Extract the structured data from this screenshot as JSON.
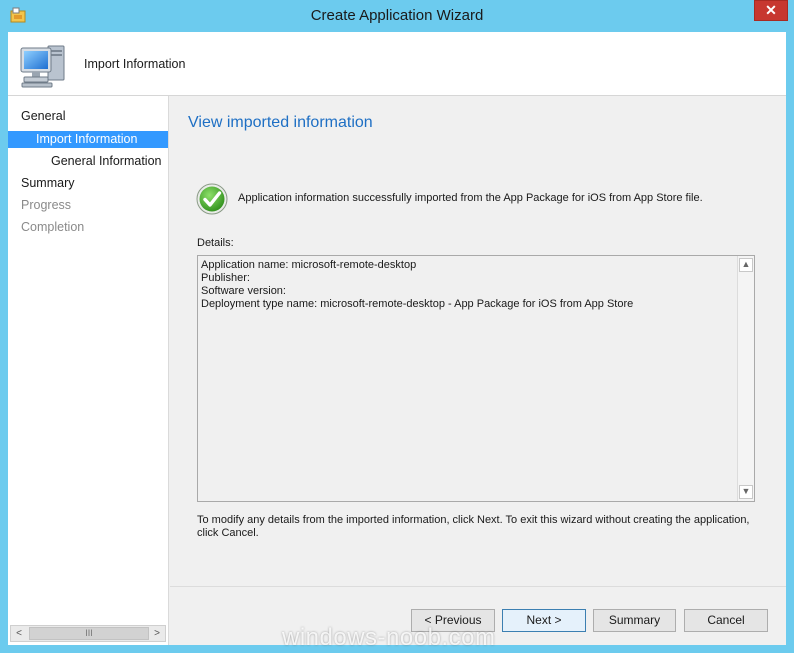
{
  "window": {
    "title": "Create Application Wizard",
    "close_label": "✕"
  },
  "header": {
    "title": "Import Information",
    "icon": "computer-icon"
  },
  "nav": {
    "items": [
      {
        "label": "General",
        "state": "normal"
      },
      {
        "label": "Import Information",
        "state": "selected"
      },
      {
        "label": "General Information",
        "state": "normal"
      },
      {
        "label": "Summary",
        "state": "normal"
      },
      {
        "label": "Progress",
        "state": "disabled"
      },
      {
        "label": "Completion",
        "state": "disabled"
      }
    ],
    "scrollbar": {
      "left_arrow": "<",
      "right_arrow": ">",
      "thumb_grip": "III"
    }
  },
  "main": {
    "page_title": "View imported information",
    "success_icon": "checkmark-icon",
    "success_text": "Application information successfully imported from the App Package for iOS from App Store file.",
    "details_label": "Details:",
    "details_text": "Application name: microsoft-remote-desktop\nPublisher:\nSoftware version:\nDeployment type name: microsoft-remote-desktop - App Package for iOS from App Store",
    "hint": "To modify any details from the imported information, click Next. To exit this wizard without creating the application, click Cancel."
  },
  "buttons": {
    "previous": "< Previous",
    "next": "Next >",
    "summary": "Summary",
    "cancel": "Cancel"
  },
  "watermark": "windows-noob.com",
  "colors": {
    "frame": "#6ccbee",
    "accent_title": "#1e6fc4",
    "selection": "#3399ff",
    "close": "#c7372f"
  }
}
